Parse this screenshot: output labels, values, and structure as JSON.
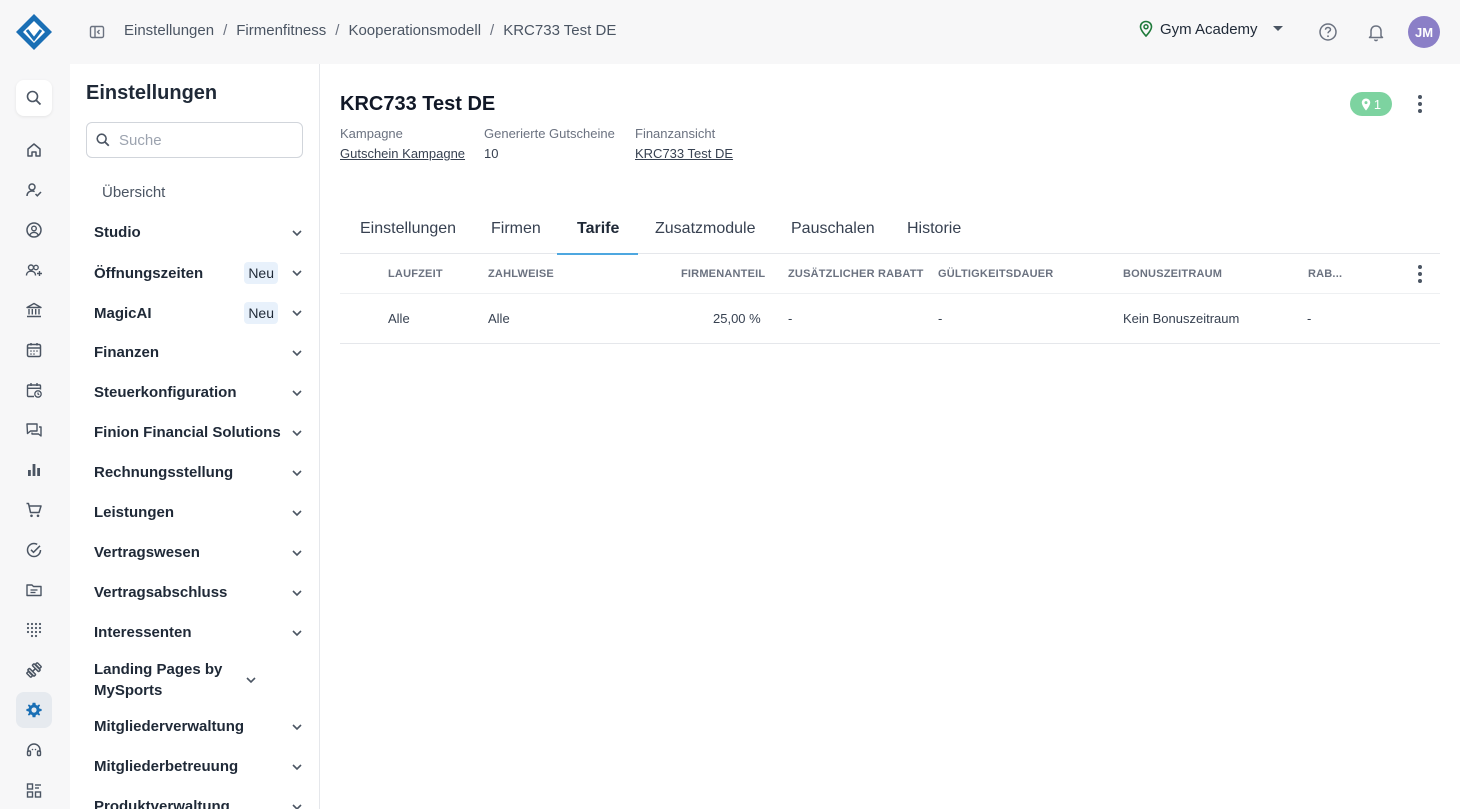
{
  "breadcrumb": [
    "Einstellungen",
    "Firmenfitness",
    "Kooperationsmodell",
    "KRC733 Test DE"
  ],
  "header": {
    "studio": "Gym Academy",
    "avatar_initials": "JM"
  },
  "sidebar": {
    "title": "Einstellungen",
    "search_placeholder": "Suche",
    "overview": "Übersicht",
    "items": [
      {
        "label": "Studio"
      },
      {
        "label": "Öffnungszeiten",
        "badge": "Neu"
      },
      {
        "label": "MagicAI",
        "badge": "Neu"
      },
      {
        "label": "Finanzen"
      },
      {
        "label": "Steuerkonfiguration"
      },
      {
        "label": "Finion Financial Solutions"
      },
      {
        "label": "Rechnungsstellung"
      },
      {
        "label": "Leistungen"
      },
      {
        "label": "Vertragswesen"
      },
      {
        "label": "Vertragsabschluss"
      },
      {
        "label": "Interessenten"
      },
      {
        "label": "Landing Pages by MySports"
      },
      {
        "label": "Mitgliederverwaltung"
      },
      {
        "label": "Mitgliederbetreuung"
      },
      {
        "label": "Produktverwaltung"
      }
    ]
  },
  "main": {
    "title": "KRC733 Test DE",
    "pin_count": "1",
    "meta": [
      {
        "label": "Kampagne",
        "value": "Gutschein Kampagne",
        "link": true
      },
      {
        "label": "Generierte Gutscheine",
        "value": "10",
        "link": false
      },
      {
        "label": "Finanzansicht",
        "value": "KRC733 Test DE",
        "link": true
      }
    ],
    "tabs": [
      "Einstellungen",
      "Firmen",
      "Tarife",
      "Zusatzmodule",
      "Pauschalen",
      "Historie"
    ],
    "active_tab": "Tarife",
    "table": {
      "columns": [
        "Laufzeit",
        "Zahlweise",
        "Firmenanteil",
        "Zusätzlicher Rabatt",
        "Gültigkeitsdauer",
        "Bonuszeitraum",
        "Rab..."
      ],
      "rows": [
        [
          "Alle",
          "Alle",
          "25,00 %",
          "-",
          "-",
          "Kein Bonuszeitraum",
          "-"
        ]
      ]
    }
  },
  "colors": {
    "accent": "#1a6fb5",
    "badge_green": "#7dd3a0",
    "tab_underline": "#4ea7e0",
    "avatar": "#8b7fc7"
  }
}
